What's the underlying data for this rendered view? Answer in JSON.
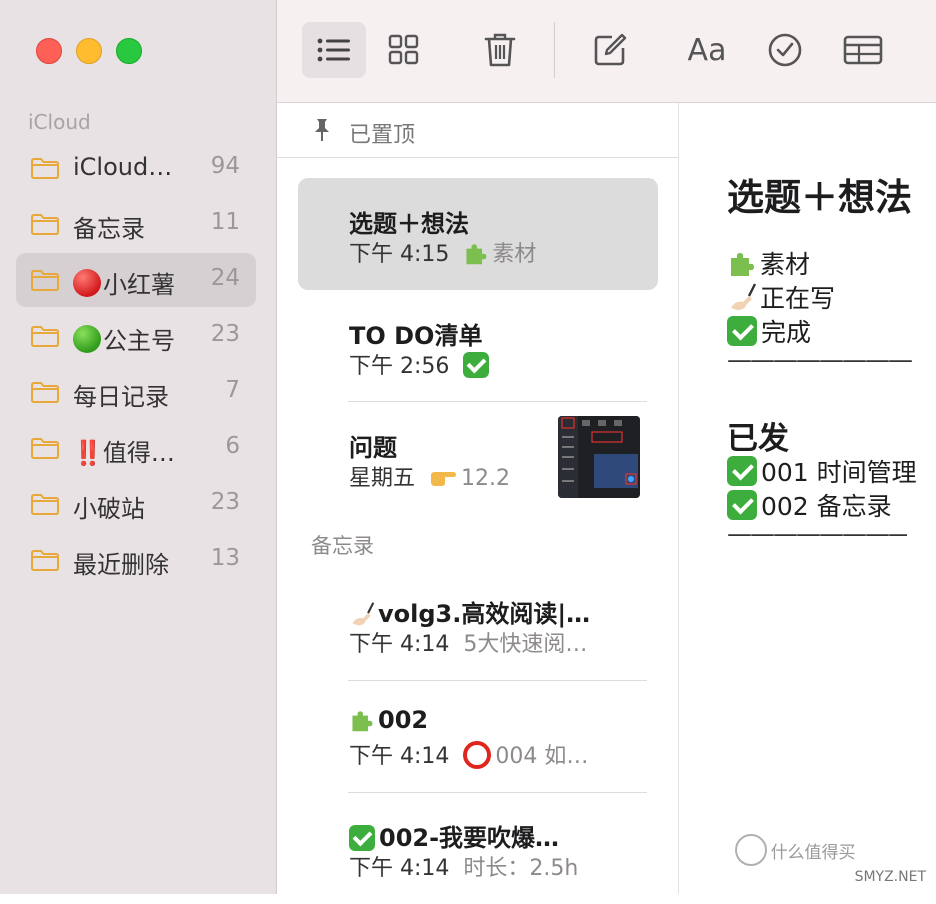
{
  "sidebar": {
    "section_label": "iCloud",
    "folders": [
      {
        "name": "iCloud…",
        "count": "94"
      },
      {
        "name": "备忘录",
        "count": "11"
      },
      {
        "name": "小红薯",
        "count": "24",
        "emoji": "red-circle"
      },
      {
        "name": "公主号",
        "count": "23",
        "emoji": "green-circle"
      },
      {
        "name": "每日记录",
        "count": "7"
      },
      {
        "name": "值得…",
        "count": "6",
        "emoji_text": "‼️"
      },
      {
        "name": "小破站",
        "count": "23"
      },
      {
        "name": "最近删除",
        "count": "13"
      }
    ]
  },
  "toolbar": {
    "icons": [
      "list-view-icon",
      "gallery-view-icon",
      "trash-icon",
      "compose-icon",
      "format-text-icon",
      "checklist-icon",
      "table-icon"
    ],
    "format_label": "Aa"
  },
  "list": {
    "pinned_label": "已置顶",
    "group_label": "备忘录",
    "notes": [
      {
        "title": "选题＋想法",
        "time": "下午 4:15",
        "preview": "素材",
        "preview_icon": "puzzle"
      },
      {
        "title": "TO DO清单",
        "time": "下午 2:56",
        "preview": "",
        "preview_icon": "check"
      },
      {
        "title": "问题",
        "time": "星期五",
        "preview": "12.2",
        "preview_icon": "pointing-hand"
      },
      {
        "title": "volg3.高效阅读|…",
        "time": "下午 4:14",
        "preview": "5大快速阅…",
        "title_icon": "writing-hand"
      },
      {
        "title": "002",
        "time": "下午 4:14",
        "preview": "004 如…",
        "title_icon": "puzzle",
        "preview_icon": "red-ring"
      },
      {
        "title": "002-我要吹爆…",
        "time": "下午 4:14",
        "preview": "时长：2.5h",
        "title_icon": "check"
      }
    ]
  },
  "editor": {
    "title": "选题＋想法",
    "lines": [
      "素材",
      "正在写",
      "完成"
    ],
    "rule1": "————————",
    "heading": "已发",
    "items": [
      "001 时间管理",
      "002 备忘录"
    ],
    "rule2": "————————"
  },
  "watermark": "什么值得买",
  "watermark_sub": "SMYZ.NET",
  "colors": {
    "sidebar_bg": "#e8e2e4",
    "toolbar_bg": "#f6f0f1",
    "folder_icon": "#e8a83a",
    "selected_row": "#d6d0d2",
    "check_green": "#3dad3d"
  }
}
